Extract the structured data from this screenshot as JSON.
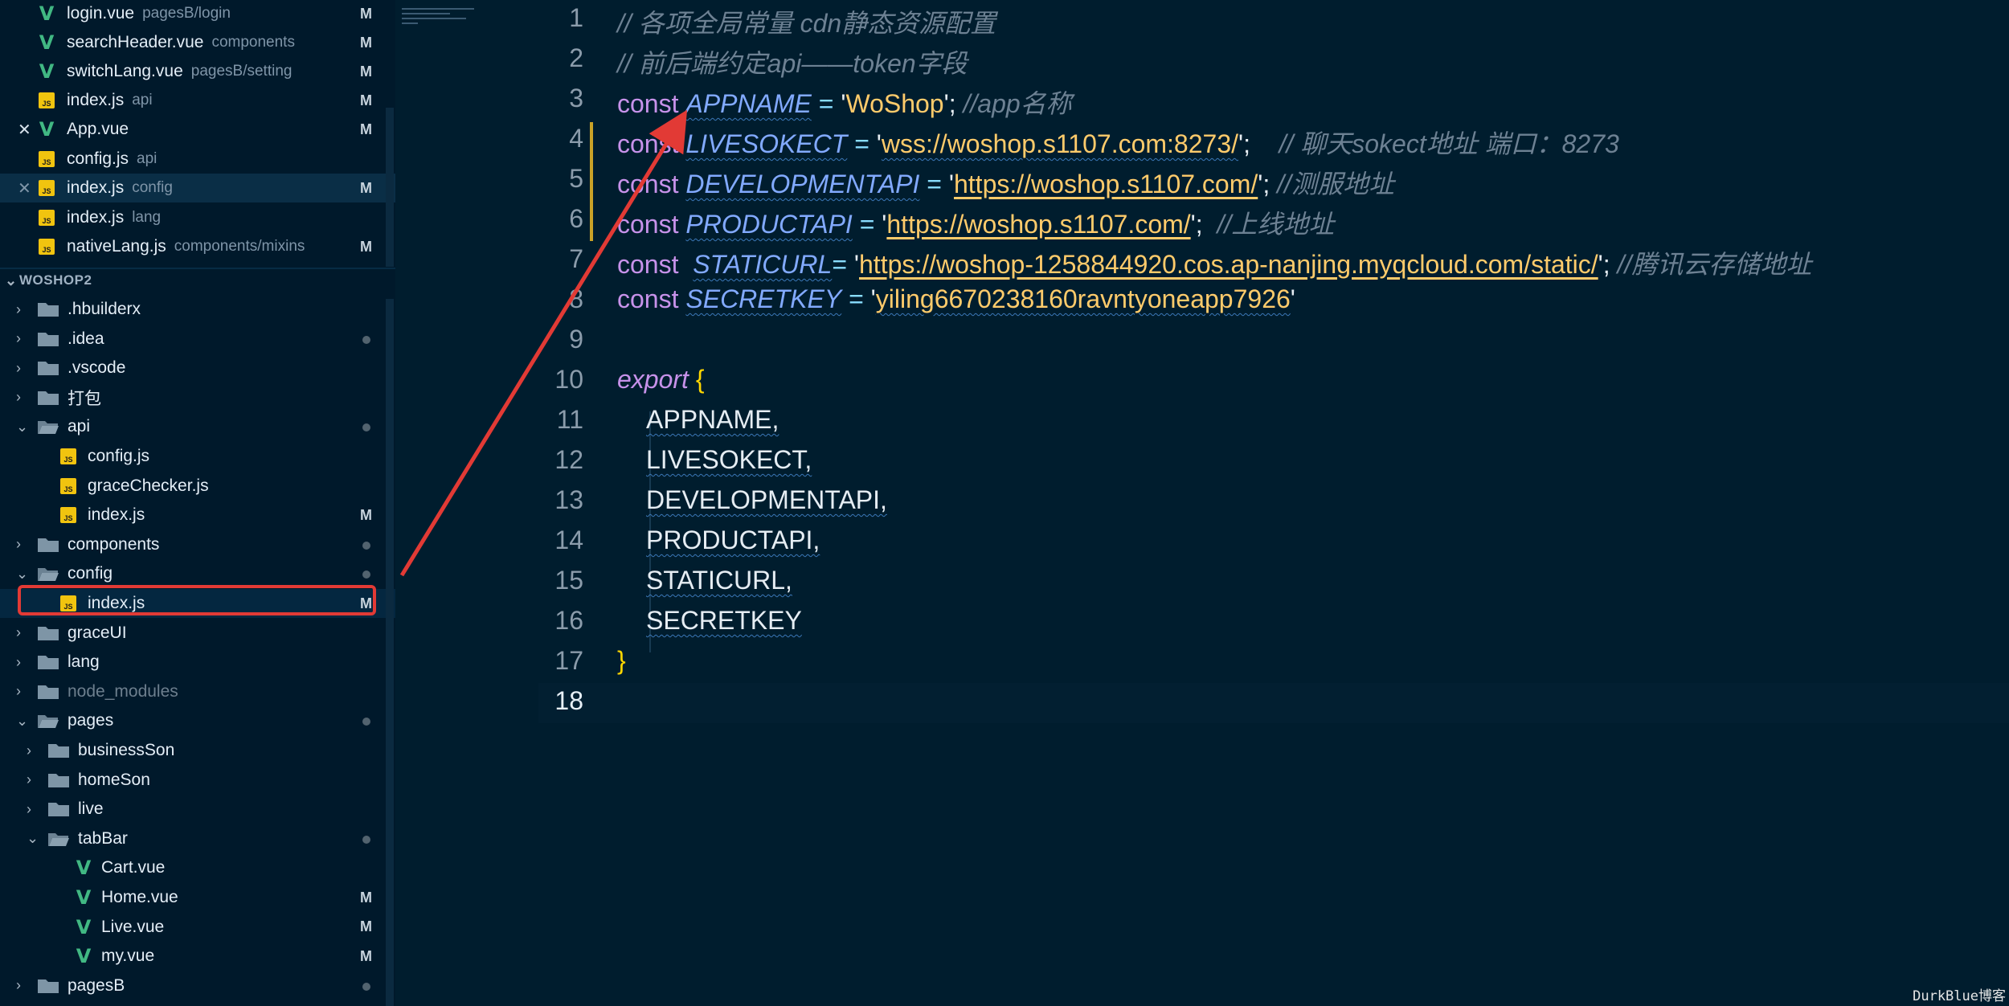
{
  "sidebar": {
    "open_editors": [
      {
        "name": "login.vue",
        "desc": "pagesB/login",
        "type": "vue",
        "status": "M"
      },
      {
        "name": "searchHeader.vue",
        "desc": "components",
        "type": "vue",
        "status": "M"
      },
      {
        "name": "switchLang.vue",
        "desc": "pagesB/setting",
        "type": "vue",
        "status": "M"
      },
      {
        "name": "index.js",
        "desc": "api",
        "type": "js",
        "status": "M"
      },
      {
        "name": "App.vue",
        "desc": "",
        "type": "vue",
        "status": "M",
        "close": "✕"
      },
      {
        "name": "config.js",
        "desc": "api",
        "type": "js",
        "status": ""
      },
      {
        "name": "index.js",
        "desc": "config",
        "type": "js",
        "status": "M",
        "close": "✕"
      },
      {
        "name": "index.js",
        "desc": "lang",
        "type": "js",
        "status": ""
      },
      {
        "name": "nativeLang.js",
        "desc": "components/mixins",
        "type": "js",
        "status": "M"
      }
    ],
    "project_title": "WOSHOP2",
    "tree": [
      {
        "name": ".hbuilderx",
        "kind": "folder",
        "open": false,
        "dot": false
      },
      {
        "name": ".idea",
        "kind": "folder",
        "open": false,
        "dot": true
      },
      {
        "name": ".vscode",
        "kind": "folder",
        "open": false,
        "dot": false
      },
      {
        "name": "打包",
        "kind": "folder",
        "open": false,
        "dot": false
      },
      {
        "name": "api",
        "kind": "folder",
        "open": true,
        "dot": true
      },
      {
        "name": "config.js",
        "kind": "js",
        "status": ""
      },
      {
        "name": "graceChecker.js",
        "kind": "js",
        "status": ""
      },
      {
        "name": "index.js",
        "kind": "js",
        "status": "M"
      },
      {
        "name": "components",
        "kind": "folder",
        "open": false,
        "dot": true
      },
      {
        "name": "config",
        "kind": "folder",
        "open": true,
        "dot": true
      },
      {
        "name": "index.js",
        "kind": "js",
        "status": "M"
      },
      {
        "name": "graceUI",
        "kind": "folder",
        "open": false,
        "dot": false
      },
      {
        "name": "lang",
        "kind": "folder",
        "open": false,
        "dot": false
      },
      {
        "name": "node_modules",
        "kind": "folder",
        "open": false,
        "dot": false
      },
      {
        "name": "pages",
        "kind": "folder",
        "open": true,
        "dot": true
      },
      {
        "name": "businessSon",
        "kind": "folder",
        "open": false,
        "dot": false
      },
      {
        "name": "homeSon",
        "kind": "folder",
        "open": false,
        "dot": false
      },
      {
        "name": "live",
        "kind": "folder",
        "open": false,
        "dot": false
      },
      {
        "name": "tabBar",
        "kind": "folder",
        "open": true,
        "dot": true
      },
      {
        "name": "Cart.vue",
        "kind": "vue",
        "status": ""
      },
      {
        "name": "Home.vue",
        "kind": "vue",
        "status": "M"
      },
      {
        "name": "Live.vue",
        "kind": "vue",
        "status": "M"
      },
      {
        "name": "my.vue",
        "kind": "vue",
        "status": "M"
      },
      {
        "name": "pagesB",
        "kind": "folder",
        "open": false,
        "dot": true
      }
    ]
  },
  "editor": {
    "line_numbers": [
      "1",
      "2",
      "3",
      "4",
      "5",
      "6",
      "7",
      "8",
      "9",
      "10",
      "11",
      "12",
      "13",
      "14",
      "15",
      "16",
      "17",
      "18"
    ],
    "l1": "// 各项全局常量 cdn静态资源配置",
    "l2": "// 前后端约定api——token字段",
    "l3": {
      "kw": "const",
      "name": "APPNAME",
      "eq": "=",
      "q1": "'",
      "val": "WoShop",
      "q2": "';",
      "cm": "//app名称"
    },
    "l4": {
      "kw": "const",
      "name": "LIVESOKECT",
      "eq": "=",
      "q1": "'",
      "val": "wss://woshop.s1107.com:8273/",
      "q2": "';",
      "cm": "// 聊天sokect地址  端口：8273"
    },
    "l5": {
      "kw": "const",
      "name": "DEVELOPMENTAPI",
      "eq": "=",
      "q1": "'",
      "val": "https://woshop.s1107.com/",
      "q2": "';",
      "cm": "//测服地址"
    },
    "l6": {
      "kw": "const",
      "name": "PRODUCTAPI",
      "eq": "=",
      "q1": "'",
      "val": "https://woshop.s1107.com/",
      "q2": "';",
      "cm": "//上线地址"
    },
    "l7": {
      "kw": "const",
      "name": "STATICURL",
      "eq": "=",
      "q1": "'",
      "val": "https://woshop-1258844920.cos.ap-nanjing.myqcloud.com/static/",
      "q2": "';",
      "cm": "//腾讯云存储地址"
    },
    "l8": {
      "kw": "const",
      "name": "SECRETKEY",
      "eq": "=",
      "q1": "'",
      "val": "yiling6670238160ravntyoneapp7926",
      "q2": "'"
    },
    "l10": {
      "kw": "export",
      "brace": "{"
    },
    "exports": [
      "APPNAME,",
      "LIVESOKECT,",
      "DEVELOPMENTAPI,",
      "PRODUCTAPI,",
      "STATICURL,",
      "SECRETKEY"
    ],
    "l17": "}"
  },
  "watermark": "DurkBlue博客",
  "colors": {
    "highlight": "#e23a35",
    "background": "#001d2e"
  }
}
